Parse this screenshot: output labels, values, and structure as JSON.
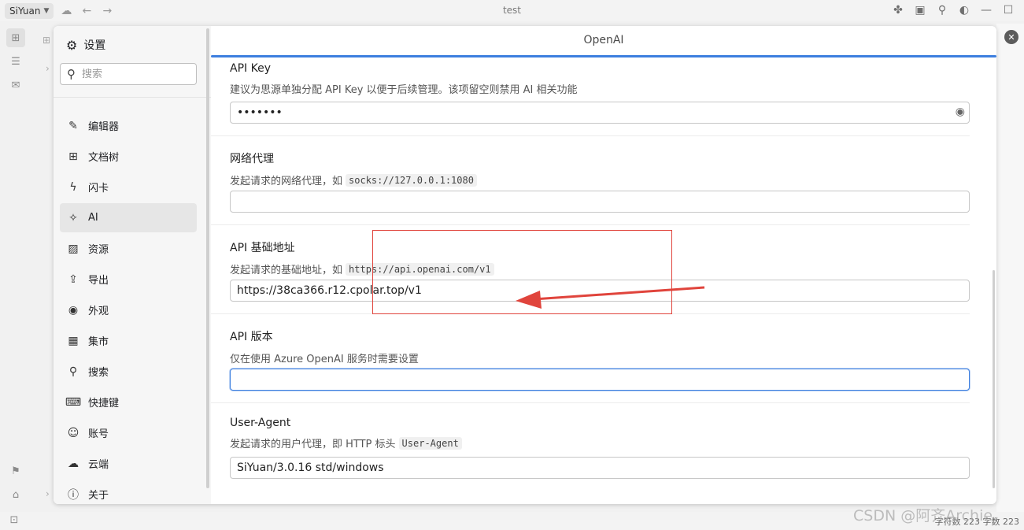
{
  "topbar": {
    "workspace": "SiYuan",
    "title": "test"
  },
  "dialog": {
    "sidebar": {
      "header": "设置",
      "search_placeholder": "搜索",
      "items": [
        {
          "label": "编辑器",
          "icon": "pen-icon"
        },
        {
          "label": "文档树",
          "icon": "tree-icon"
        },
        {
          "label": "闪卡",
          "icon": "flash-icon"
        },
        {
          "label": "AI",
          "icon": "sparkle-icon",
          "active": true
        },
        {
          "label": "资源",
          "icon": "image-icon"
        },
        {
          "label": "导出",
          "icon": "export-icon"
        },
        {
          "label": "外观",
          "icon": "palette-icon"
        },
        {
          "label": "集市",
          "icon": "store-icon"
        },
        {
          "label": "搜索",
          "icon": "search-icon"
        },
        {
          "label": "快捷键",
          "icon": "keyboard-icon"
        },
        {
          "label": "账号",
          "icon": "account-icon"
        },
        {
          "label": "云端",
          "icon": "cloud-icon"
        },
        {
          "label": "关于",
          "icon": "info-icon"
        }
      ]
    },
    "main": {
      "title": "OpenAI",
      "fields": {
        "api_key": {
          "label": "API Key",
          "desc": "建议为思源单独分配 API Key 以便于后续管理。该项留空则禁用 AI 相关功能",
          "value": "•••••••"
        },
        "proxy": {
          "label": "网络代理",
          "desc": "发起请求的网络代理，如",
          "code": "socks://127.0.0.1:1080",
          "value": ""
        },
        "base_url": {
          "label": "API 基础地址",
          "desc": "发起请求的基础地址，如",
          "code": "https://api.openai.com/v1",
          "value": "https://38ca366.r12.cpolar.top/v1"
        },
        "version": {
          "label": "API 版本",
          "desc": "仅在使用 Azure OpenAI 服务时需要设置",
          "value": ""
        },
        "user_agent": {
          "label": "User-Agent",
          "desc": "发起请求的用户代理，即 HTTP 标头",
          "code": "User-Agent",
          "value": "SiYuan/3.0.16 std/windows"
        }
      }
    }
  },
  "statusbar": {
    "text": "字符数 223  字数 223"
  },
  "watermark": "CSDN @阿齐Archie",
  "colors": {
    "accent": "#3d7fdf",
    "annotation_red": "#e0443c"
  }
}
